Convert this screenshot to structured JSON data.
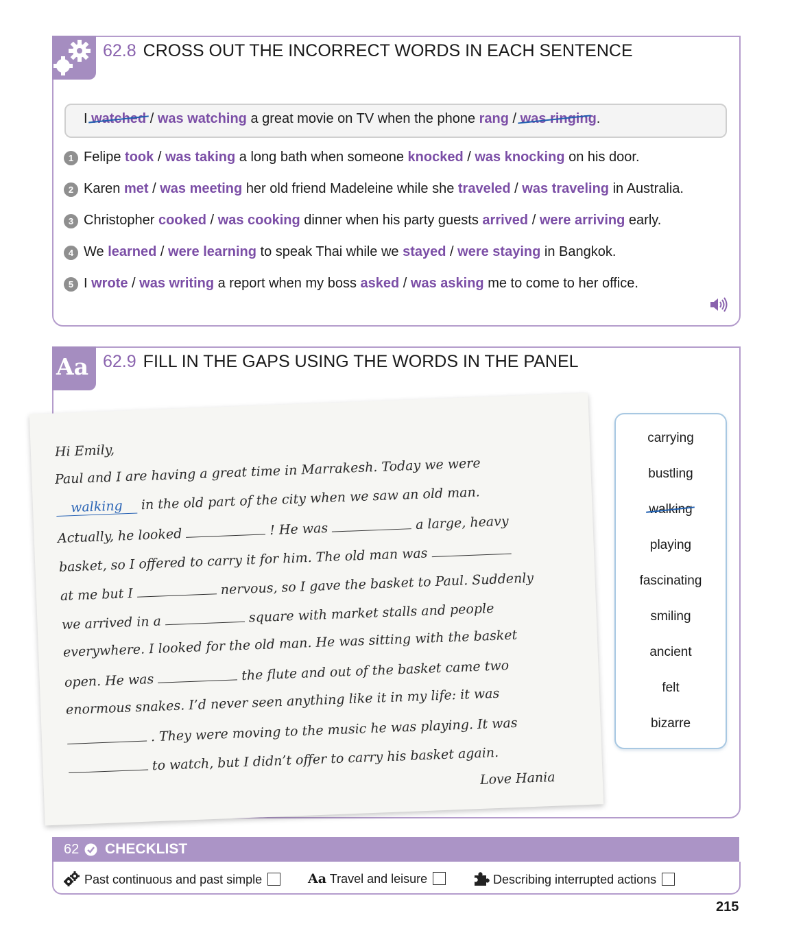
{
  "ex1": {
    "number": "62.8",
    "title": "CROSS OUT THE INCORRECT WORDS IN EACH SENTENCE",
    "example": {
      "pre": "I",
      "opt1": "watched",
      "opt2": "was watching",
      "mid": "a great movie on TV when the phone",
      "opt3": "rang",
      "opt4a": "was ringin",
      "opt4b": "g",
      "post": "."
    },
    "items": [
      {
        "n": "1",
        "pre": "Felipe",
        "a": "took",
        "b": "was taking",
        "mid": "a long bath when someone",
        "c": "knocked",
        "d": "was knocking",
        "post": "on his door."
      },
      {
        "n": "2",
        "pre": "Karen",
        "a": "met",
        "b": "was meeting",
        "mid": "her old friend Madeleine while she",
        "c": "traveled",
        "d": "was traveling",
        "post": "in Australia."
      },
      {
        "n": "3",
        "pre": "Christopher",
        "a": "cooked",
        "b": "was cooking",
        "mid": "dinner when his party guests",
        "c": "arrived",
        "d": "were arriving",
        "post": "early."
      },
      {
        "n": "4",
        "pre": "We",
        "a": "learned",
        "b": "were learning",
        "mid": "to speak Thai while we",
        "c": "stayed",
        "d": "were staying",
        "post": "in Bangkok."
      },
      {
        "n": "5",
        "pre": "I",
        "a": "wrote",
        "b": "was writing",
        "mid": "a report when my boss",
        "c": "asked",
        "d": "was asking",
        "post": "me to come to her office."
      }
    ],
    "slash": "/"
  },
  "ex2": {
    "number": "62.9",
    "title": "FILL IN THE GAPS USING THE WORDS IN THE PANEL",
    "tab": "Aa",
    "letter": {
      "greeting": "Hi Emily,",
      "l1": "Paul and I are having a great time in Marrakesh. Today we were",
      "answer": "walking",
      "l2": "in the old part of the city when we saw an old man.",
      "l3a": "Actually, he looked",
      "l3b": "! He was",
      "l3c": "a large, heavy",
      "l4": "basket, so I offered to carry it for him.  The old man was",
      "l5a": "at me but I",
      "l5b": "nervous, so I gave the basket to Paul. Suddenly",
      "l6a": "we arrived in a",
      "l6b": "square with market stalls and people",
      "l7": "everywhere. I looked for the old man. He was sitting with the basket",
      "l8a": "open. He was",
      "l8b": "the flute and out of the basket came two",
      "l9": "enormous snakes. I’d never seen anything like it in my life: it was",
      "l10": ". They were moving to the music he was playing. It was",
      "l11": "to watch, but I didn’t offer to carry his basket again.",
      "sign": "Love Hania"
    },
    "words": [
      "carrying",
      "bustling",
      "walking",
      "playing",
      "fascinating",
      "smiling",
      "ancient",
      "felt",
      "bizarre"
    ]
  },
  "checklist": {
    "num": "62",
    "title": "CHECKLIST",
    "items": [
      "Past continuous and past simple",
      "Travel and leisure",
      "Describing interrupted actions"
    ],
    "aa": "Aa"
  },
  "page": "215",
  "colors": {
    "accent": "#a58dc0",
    "option": "#7b4ea6",
    "pen": "#1f5fb0"
  }
}
